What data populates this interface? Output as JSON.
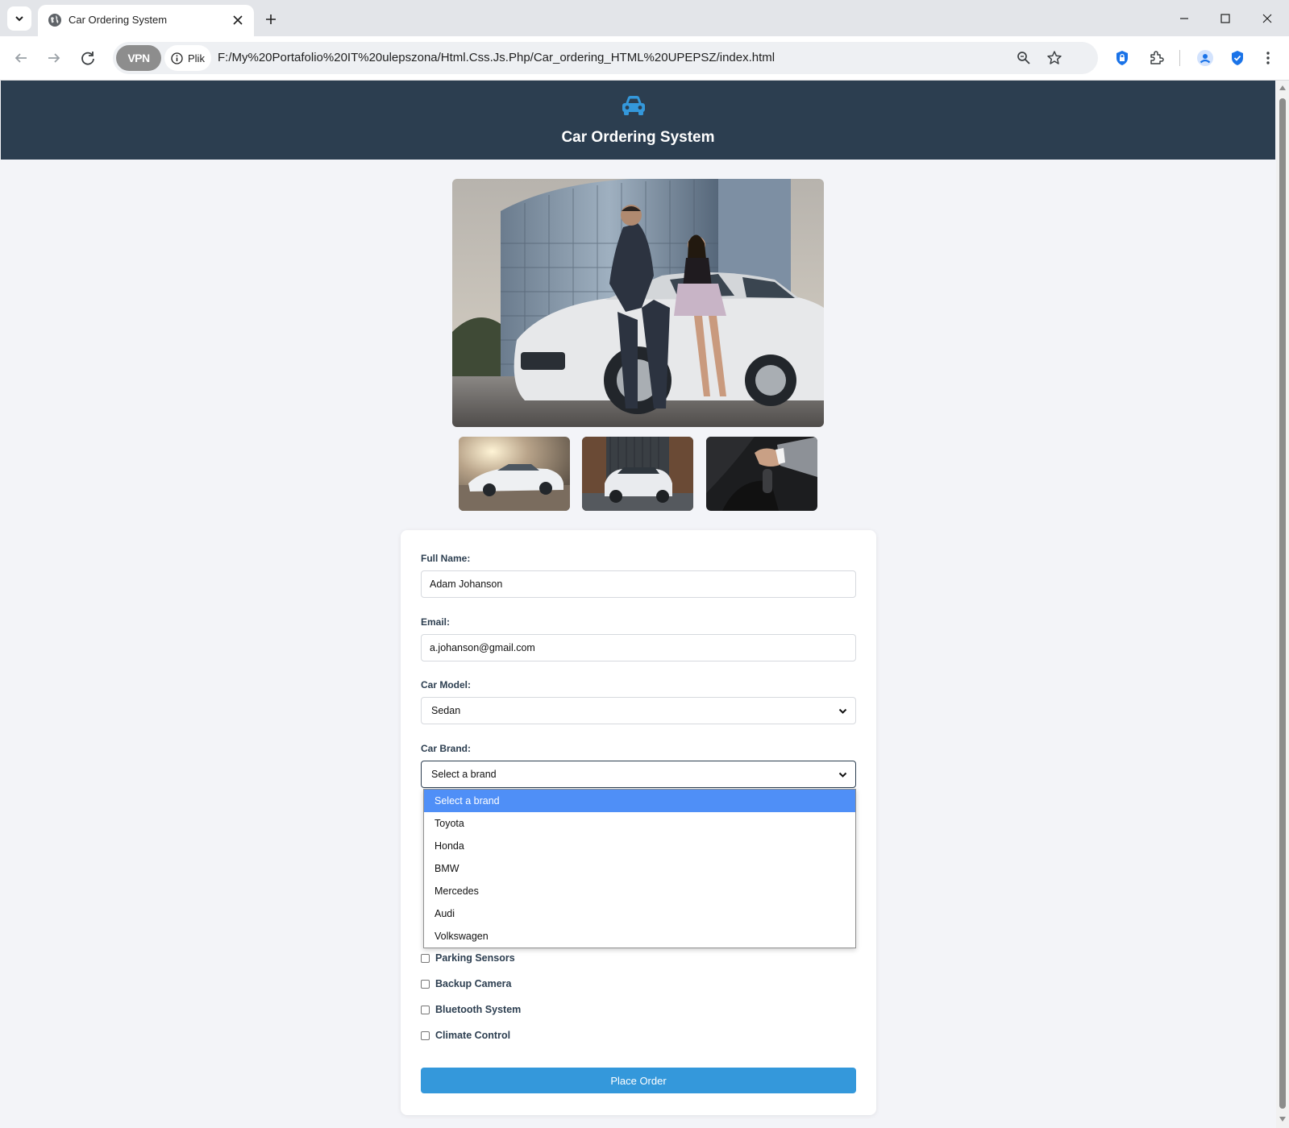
{
  "browser": {
    "tab_title": "Car Ordering System",
    "vpn_label": "VPN",
    "site_info_label": "Plik",
    "url": "F:/My%20Portafolio%20IT%20ulepszona/Html.Css.Js.Php/Car_ordering_HTML%20UPEPSZ/index.html",
    "accent_color": "#1a73e8"
  },
  "header": {
    "title": "Car Ordering System",
    "icon": "car-icon",
    "background": "#2c3e50",
    "icon_color": "#3498db"
  },
  "gallery": {
    "main_image": "man and woman posing with white sports coupe in front of glass office building",
    "thumbnails": [
      "white sports coupe at sunset",
      "white SUV between shipping containers",
      "hand on automatic gear shifter"
    ]
  },
  "form": {
    "full_name_label": "Full Name:",
    "full_name_value": "Adam Johanson",
    "email_label": "Email:",
    "email_value": "a.johanson@gmail.com",
    "car_model_label": "Car Model:",
    "car_model_value": "Sedan",
    "car_brand_label": "Car Brand:",
    "car_brand_value": "Select a brand",
    "brand_options": [
      "Select a brand",
      "Toyota",
      "Honda",
      "BMW",
      "Mercedes",
      "Audi",
      "Volkswagen"
    ],
    "extras": [
      "Parking Sensors",
      "Backup Camera",
      "Bluetooth System",
      "Climate Control"
    ],
    "submit_label": "Place Order",
    "submit_color": "#3498db"
  }
}
